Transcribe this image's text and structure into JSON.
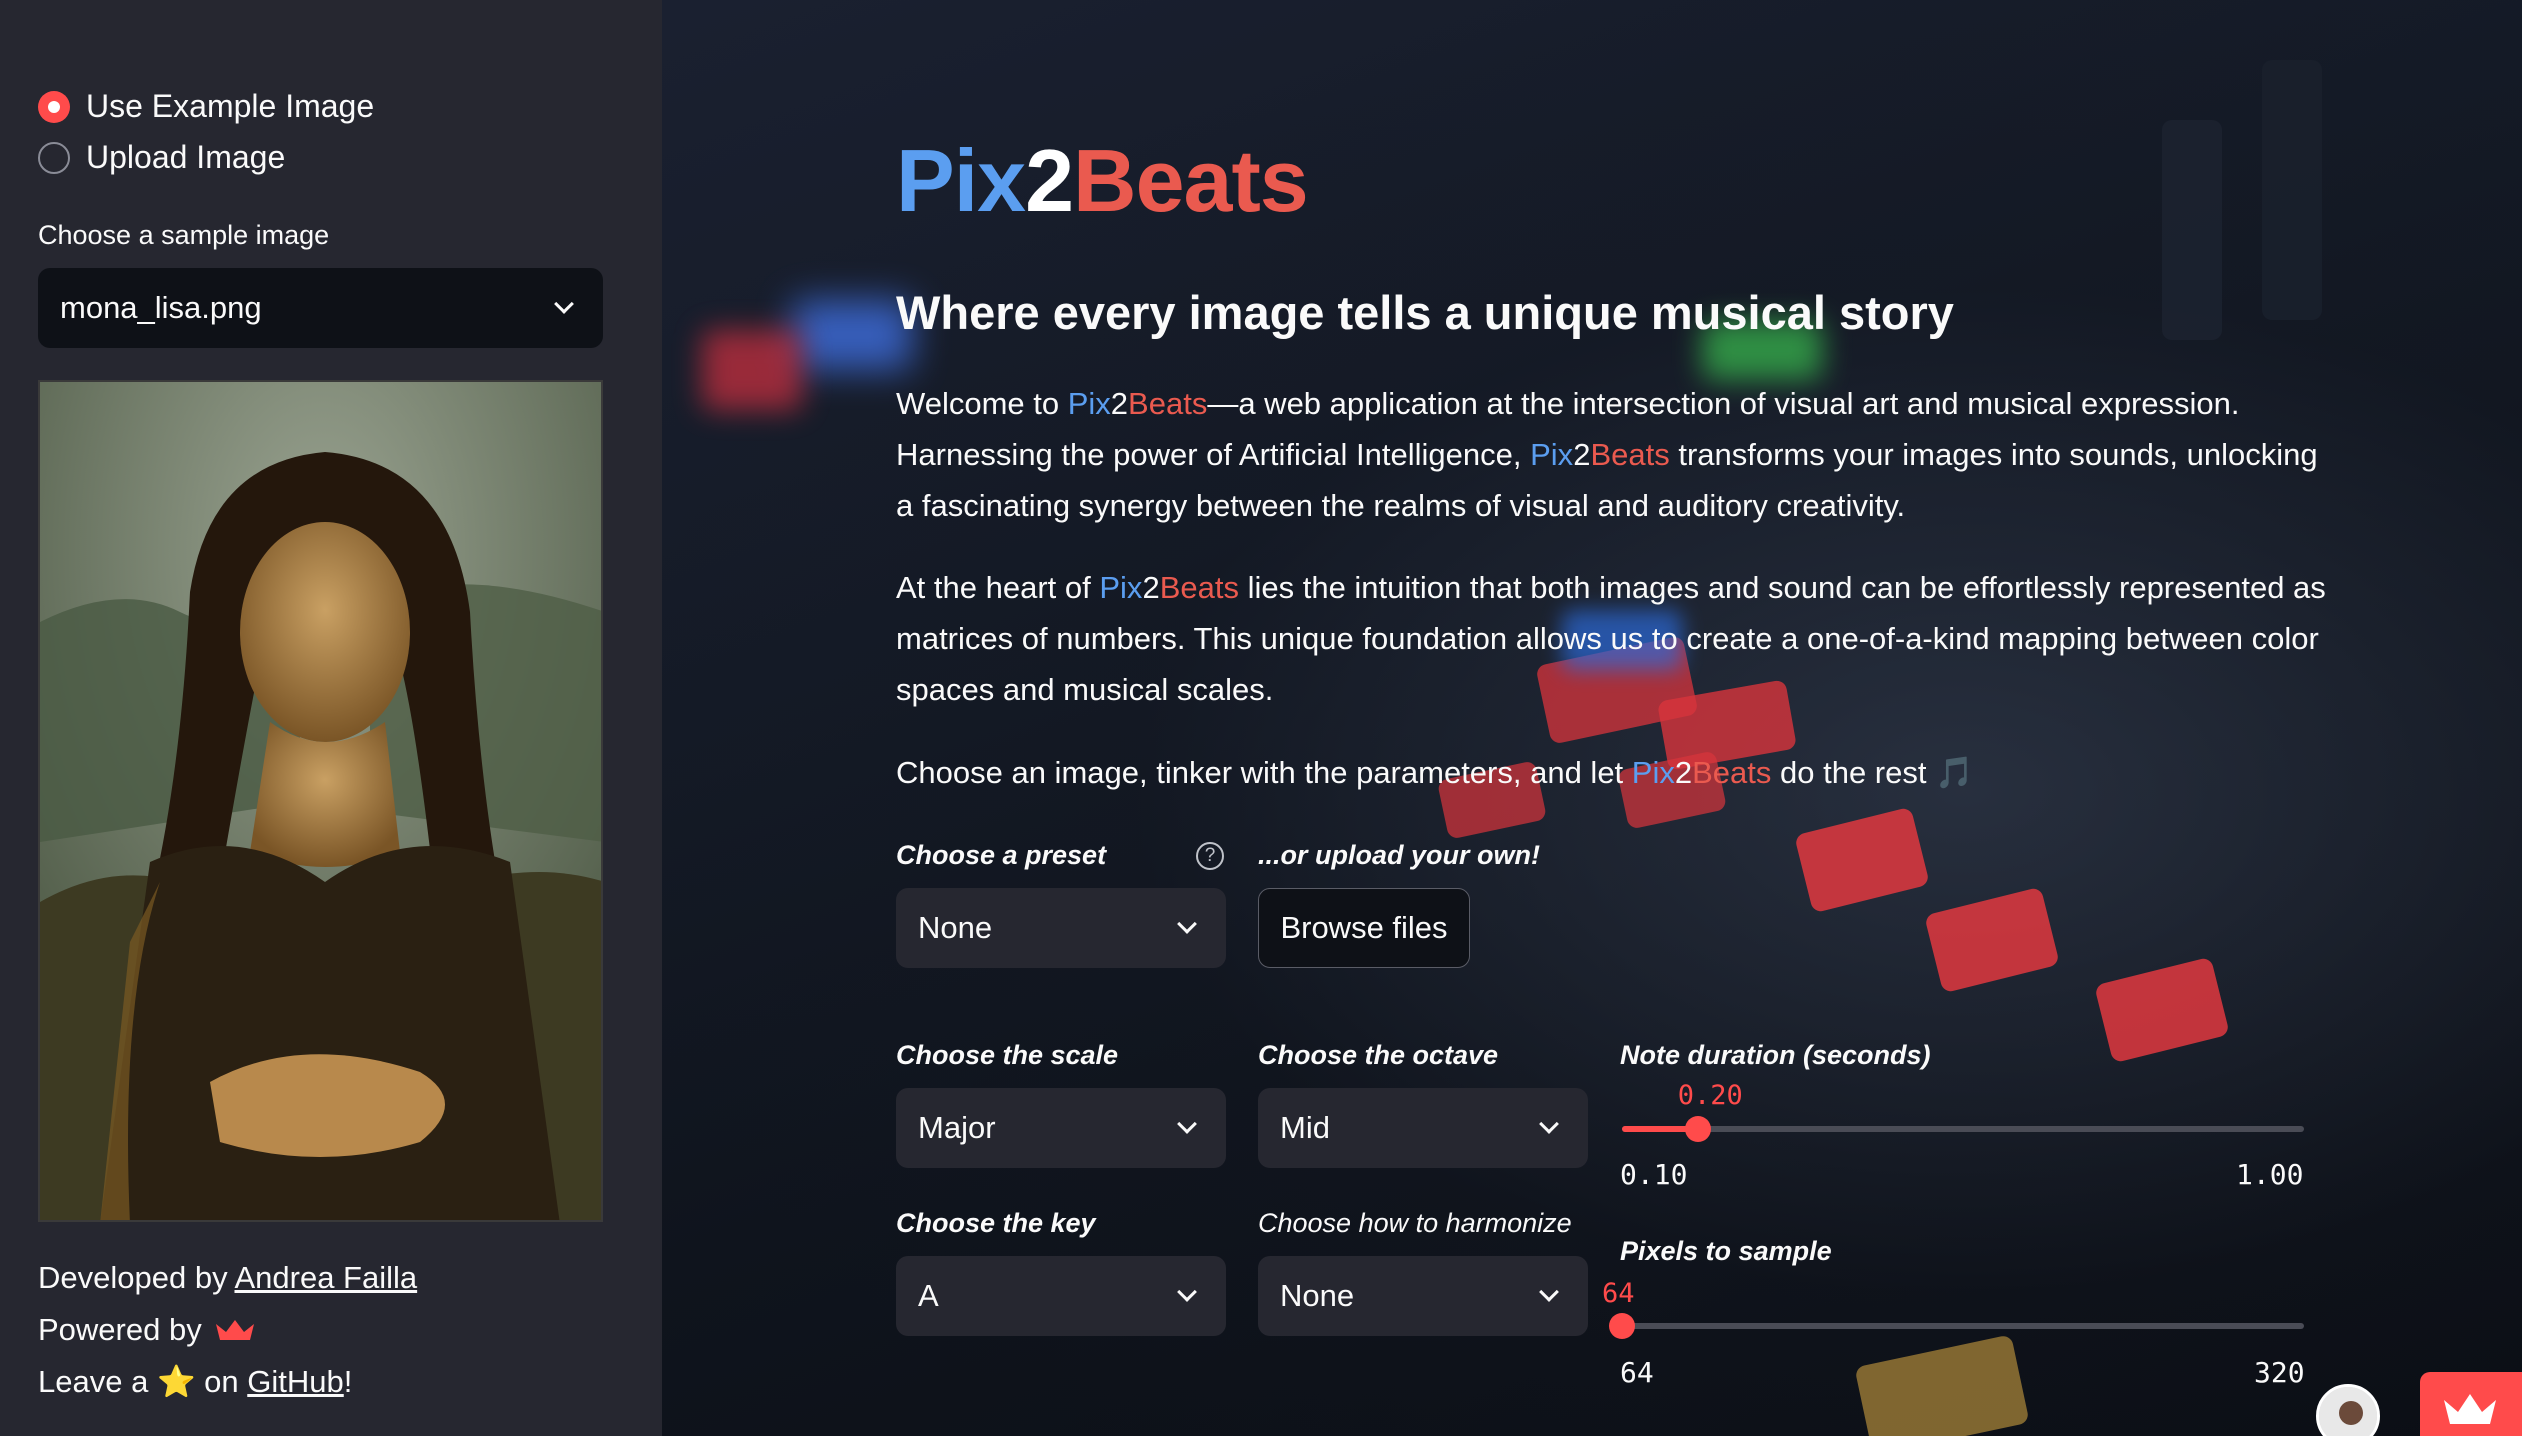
{
  "sidebar": {
    "radio_options": [
      "Use Example Image",
      "Upload Image"
    ],
    "selected_radio": 0,
    "sample_label": "Choose a sample image",
    "sample_value": "mona_lisa.png",
    "footer": {
      "developed_prefix": "Developed by ",
      "developer": "Andrea Failla",
      "powered_prefix": "Powered by ",
      "powered_icon": "streamlit-crown-icon",
      "leave_prefix": "Leave a ",
      "star": "⭐",
      "leave_mid": " on ",
      "github": "GitHub",
      "leave_suffix": "!"
    }
  },
  "main": {
    "title_parts": [
      "Pix",
      "2",
      "Beats"
    ],
    "subtitle": "Where every image tells a unique musical story",
    "brand": {
      "pix": "Pix",
      "two": "2",
      "beats": "Beats"
    },
    "para1": {
      "a": "Welcome to ",
      "b": "—a web application at the intersection of visual art and musical expression. Harnessing the power of Artificial Intelligence, ",
      "c": " transforms your images into sounds, unlocking a fascinating synergy between the realms of visual and auditory creativity."
    },
    "para2": {
      "a": "At the heart of ",
      "b": " lies the intuition that both images and sound can be effortlessly represented as matrices of numbers. This unique foundation allows us to create a one-of-a-kind mapping between color spaces and musical scales."
    },
    "para3": {
      "a": "Choose an image, tinker with the parameters, and let ",
      "b": " do the rest ",
      "note": "🎵"
    },
    "preset": {
      "label": "Choose a preset",
      "value": "None",
      "help": "?"
    },
    "upload": {
      "label": "...or upload your own!",
      "button": "Browse files"
    },
    "scale": {
      "label": "Choose the scale",
      "value": "Major"
    },
    "octave": {
      "label": "Choose the octave",
      "value": "Mid"
    },
    "key": {
      "label": "Choose the key",
      "value": "A"
    },
    "harmonize": {
      "label": "Choose how to harmonize",
      "value": "None"
    },
    "note_duration": {
      "label": "Note duration (seconds)",
      "value": "0.20",
      "min": "0.10",
      "max": "1.00",
      "fraction": 0.111
    },
    "pixels": {
      "label": "Pixels to sample",
      "value": "64",
      "min": "64",
      "max": "320",
      "fraction": 0.0
    }
  },
  "colors": {
    "accent": "#ff4b4b",
    "brand_blue": "#5b9ef0",
    "brand_red": "#ea5a4f"
  }
}
